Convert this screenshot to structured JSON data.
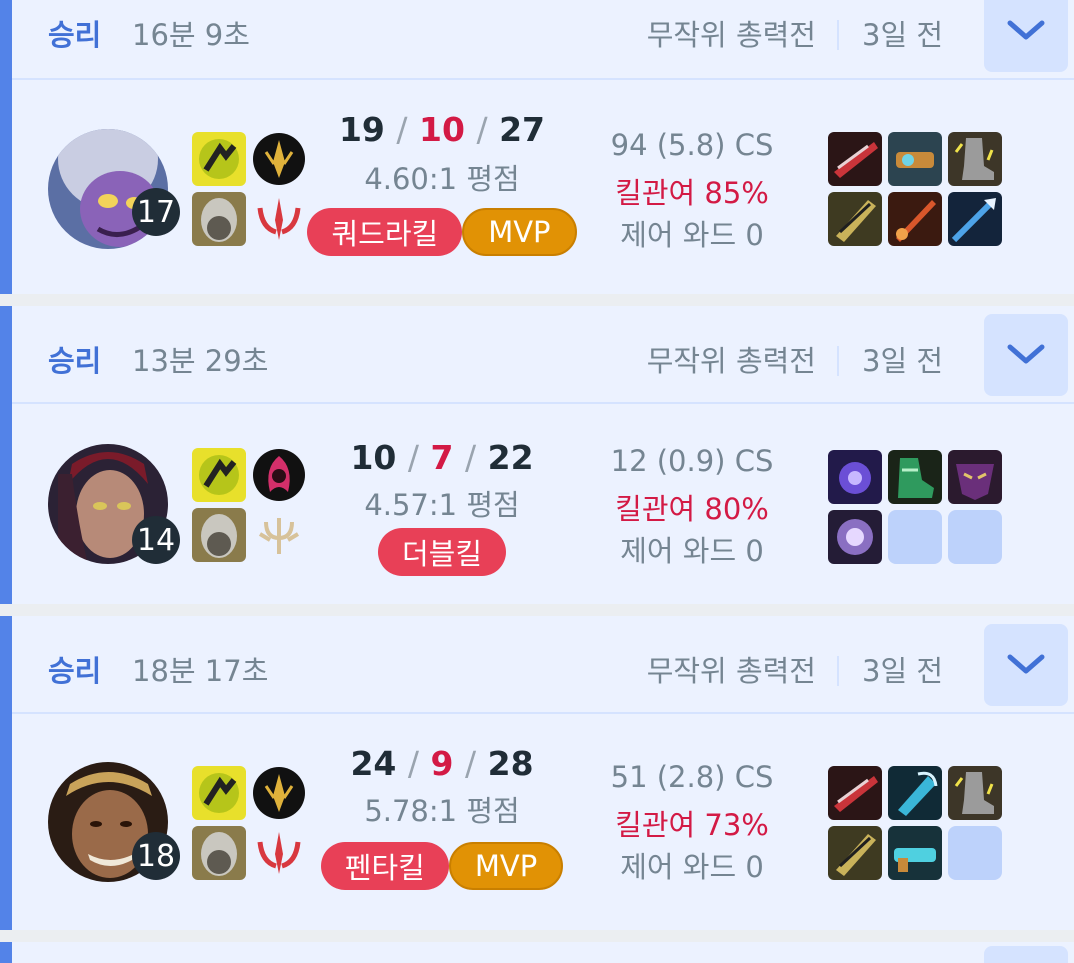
{
  "matches": [
    {
      "result": "승리",
      "duration": "16분 9초",
      "mode": "무작위 총력전",
      "time_ago": "3일 전",
      "champion": "tristana-portrait",
      "level": "17",
      "kda": {
        "kills": "19",
        "deaths": "10",
        "assists": "27",
        "sep": "/"
      },
      "ratio": "4.60:1 평점",
      "badges": [
        "쿼드라킬",
        "MVP"
      ],
      "cs": "94 (5.8) CS",
      "kill_participation": "킬관여 85%",
      "control_wards": "제어 와드 0",
      "items": [
        "red-blade-item",
        "gunblade-item",
        "boots-item",
        "golden-blade-item",
        "red-sword-item",
        "blue-spear-item"
      ]
    },
    {
      "result": "승리",
      "duration": "13분 29초",
      "mode": "무작위 총력전",
      "time_ago": "3일 전",
      "champion": "leblanc-portrait",
      "level": "14",
      "kda": {
        "kills": "10",
        "deaths": "7",
        "assists": "22",
        "sep": "/"
      },
      "ratio": "4.57:1 평점",
      "badges": [
        "더블킬"
      ],
      "cs": "12 (0.9) CS",
      "kill_participation": "킬관여 80%",
      "control_wards": "제어 와드 0",
      "items": [
        "purple-orb-item",
        "green-boots-item",
        "dark-mask-item",
        "purple-amulet-item",
        "",
        ""
      ]
    },
    {
      "result": "승리",
      "duration": "18분 17초",
      "mode": "무작위 총력전",
      "time_ago": "3일 전",
      "champion": "draven-portrait",
      "level": "18",
      "kda": {
        "kills": "24",
        "deaths": "9",
        "assists": "28",
        "sep": "/"
      },
      "ratio": "5.78:1 평점",
      "badges": [
        "펜타킬",
        "MVP"
      ],
      "cs": "51 (2.8) CS",
      "kill_participation": "킬관여 73%",
      "control_wards": "제어 와드 0",
      "items": [
        "red-blade-item",
        "blue-axe-item",
        "boots-item",
        "golden-blade-item",
        "cyan-gun-item",
        ""
      ]
    }
  ],
  "colors": {
    "win_border": "#5383e8",
    "win_bg": "#ecf2ff",
    "win_text": "#4171d6",
    "deaths": "#d31a45",
    "multi_kill_badge": "#e84057",
    "mvp_badge": "#e19205"
  }
}
